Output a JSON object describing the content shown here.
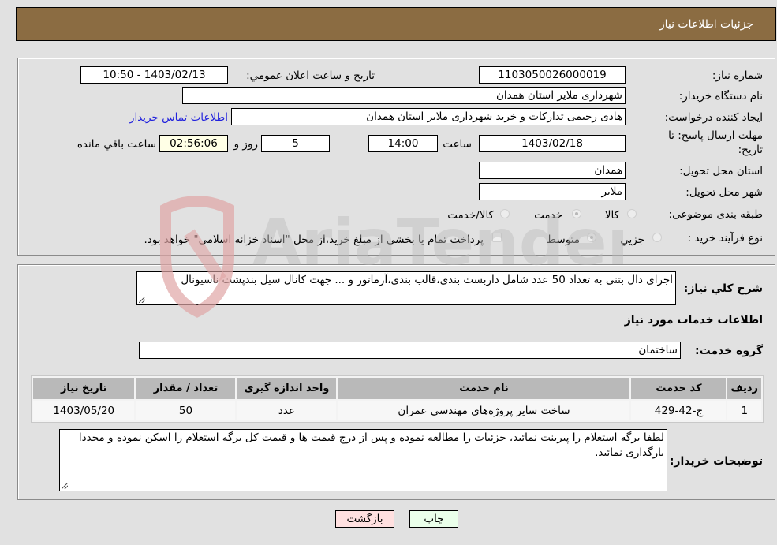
{
  "header": {
    "title": "جزئیات اطلاعات نیاز"
  },
  "info": {
    "need_number_label": "شماره نیاز:",
    "need_number": "1103050026000019",
    "announce_label": "تاریخ و ساعت اعلان عمومي:",
    "announce_value": "1403/02/13 - 10:50",
    "buyer_org_label": "نام دستگاه خريدار:",
    "buyer_org": "شهرداری ملایر استان همدان",
    "creator_label": "ایجاد کننده درخواست:",
    "creator": "هادی رحیمی تدارکات و خرید شهرداری ملایر استان همدان",
    "contact_link": "اطلاعات تماس خریدار",
    "deadline_label_1": "مهلت ارسال پاسخ: تا",
    "deadline_label_2": "تاریخ:",
    "deadline_date": "1403/02/18",
    "time_label": "ساعت",
    "deadline_time": "14:00",
    "days_value": "5",
    "days_label": "روز و",
    "remaining_time": "02:56:06",
    "remaining_label": "ساعت باقي مانده",
    "province_label": "استان محل تحویل:",
    "province": "همدان",
    "city_label": "شهر محل تحویل:",
    "city": "ملایر",
    "category_label": "طبقه بندی موضوعی:",
    "category_options": [
      "کالا",
      "خدمت",
      "کالا/خدمت"
    ],
    "category_selected": "خدمت",
    "process_label": "نوع فرآیند خرید :",
    "process_options": [
      "جزيي",
      "متوسط"
    ],
    "process_selected": "متوسط",
    "treasury_note": "پرداخت تمام یا بخشی از مبلغ خرید،از محل \"اسناد خزانه اسلامی\" خواهد بود."
  },
  "details": {
    "description_label": "شرح كلي نياز:",
    "description": "اجرای دال بتنی به تعداد 50 عدد شامل داربست بندی،قالب بندی،آرماتور و ... جهت کانال سیل بندپشت ناسیونال",
    "services_title": "اطلاعات خدمات مورد نياز",
    "service_group_label": "گروه خدمت:",
    "service_group": "ساختمان",
    "table": {
      "columns": [
        "رديف",
        "کد خدمت",
        "نام خدمت",
        "واحد اندازه گیری",
        "تعداد / مقدار",
        "تاریخ نیاز"
      ],
      "rows": [
        [
          "1",
          "ج-42-429",
          "ساخت سایر پروژه‌های مهندسی عمران",
          "عدد",
          "50",
          "1403/05/20"
        ]
      ]
    },
    "buyer_notes_label": "توضیحات خریدار:",
    "buyer_notes": "لطفا برگه استعلام را پیرینت نمائید، جزئیات را مطالعه نموده و پس از درج قیمت ها و قیمت کل برگه استعلام را اسکن نموده و مجددا بارگذاری نمائید."
  },
  "buttons": {
    "print": "چاپ",
    "back": "بازگشت"
  },
  "colors": {
    "header_bg": "#8b6c42",
    "print_bg": "#eaffea",
    "back_bg": "#ffe0e0",
    "link": "#2222dd"
  }
}
